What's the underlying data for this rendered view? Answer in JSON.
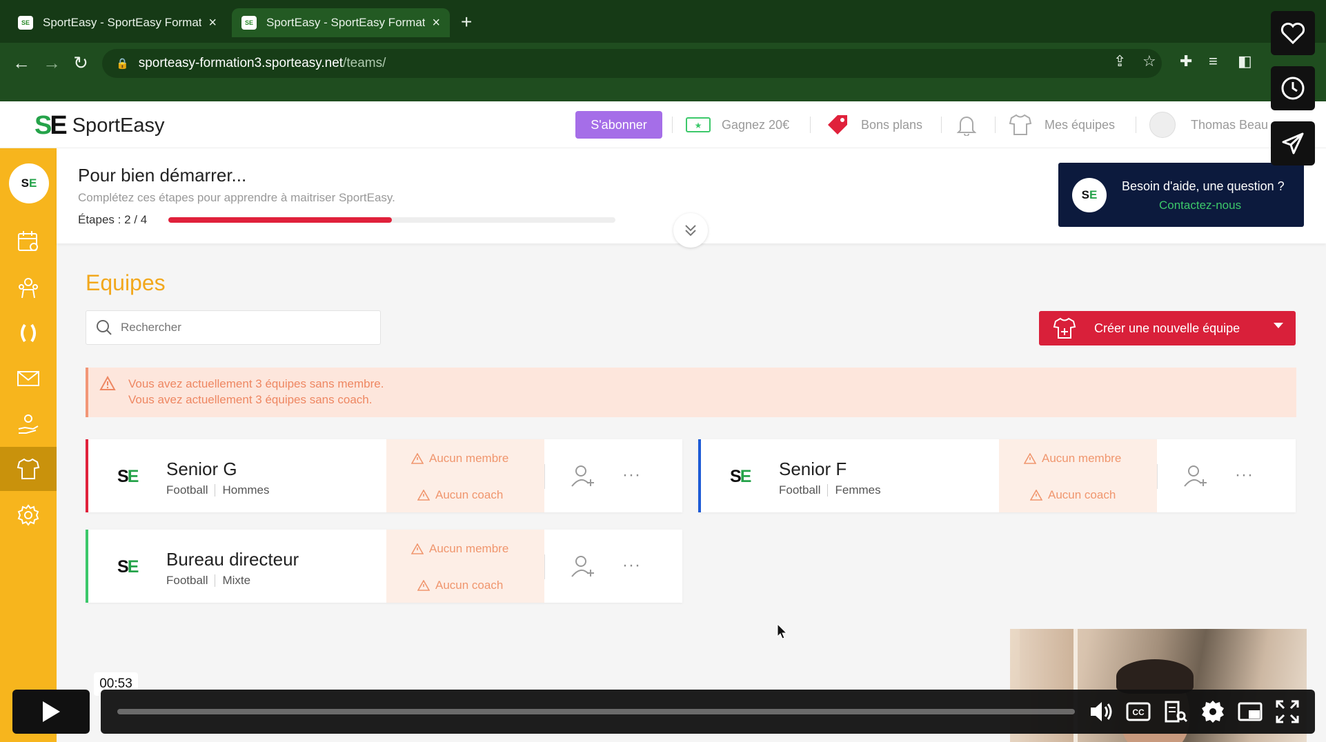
{
  "browser": {
    "tabs": [
      {
        "title": "SportEasy - SportEasy Formati",
        "active": false
      },
      {
        "title": "SportEasy - SportEasy Formati",
        "active": true
      }
    ],
    "url_host": "sporteasy-formation3.sporteasy.net",
    "url_path": "/teams/"
  },
  "header": {
    "brand": "SportEasy",
    "subscribe_label": "S'abonner",
    "earn_label": "Gagnez 20€",
    "deals_label": "Bons plans",
    "my_teams_label": "Mes équipes",
    "user_name": "Thomas Beau"
  },
  "onboarding": {
    "title": "Pour bien démarrer...",
    "subtitle": "Complétez ces étapes pour apprendre à maitriser SportEasy.",
    "steps_label": "Étapes : 2 / 4",
    "progress_fraction": 0.5
  },
  "help": {
    "question": "Besoin d'aide, une question ?",
    "contact": "Contactez-nous"
  },
  "page": {
    "heading": "Equipes",
    "search_placeholder": "Rechercher",
    "create_label": "Créer une nouvelle équipe",
    "alerts": [
      "Vous avez actuellement 3 équipes sans membre.",
      "Vous avez actuellement 3 équipes sans coach."
    ]
  },
  "teams": [
    {
      "name": "Senior G",
      "sport": "Football",
      "category": "Hommes",
      "no_member": "Aucun membre",
      "no_coach": "Aucun coach",
      "accent": "#e0213b"
    },
    {
      "name": "Senior F",
      "sport": "Football",
      "category": "Femmes",
      "no_member": "Aucun membre",
      "no_coach": "Aucun coach",
      "accent": "#1e5bd6"
    },
    {
      "name": "Bureau directeur",
      "sport": "Football",
      "category": "Mixte",
      "no_member": "Aucun membre",
      "no_coach": "Aucun coach",
      "accent": "#3cc86a"
    }
  ],
  "video": {
    "time": "00:53",
    "progress_fraction": 0.0
  },
  "colors": {
    "sidebar": "#f7b51d",
    "heading": "#f2a81d",
    "primary": "#d9203a",
    "subscribe": "#a56ee8",
    "help_bg": "#0c1a3d"
  }
}
